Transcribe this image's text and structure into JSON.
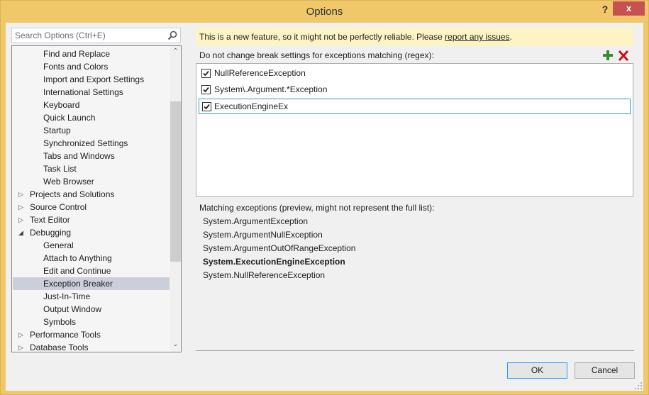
{
  "window": {
    "title": "Options",
    "help_label": "?",
    "close_label": "x",
    "frame_color": "#f0c86a",
    "close_color": "#c75050"
  },
  "search": {
    "placeholder": "Search Options (Ctrl+E)",
    "value": "",
    "icon": "search-icon"
  },
  "tree": {
    "items": [
      {
        "label": "Find and Replace",
        "level": 1,
        "expander": ""
      },
      {
        "label": "Fonts and Colors",
        "level": 1,
        "expander": ""
      },
      {
        "label": "Import and Export Settings",
        "level": 1,
        "expander": ""
      },
      {
        "label": "International Settings",
        "level": 1,
        "expander": ""
      },
      {
        "label": "Keyboard",
        "level": 1,
        "expander": ""
      },
      {
        "label": "Quick Launch",
        "level": 1,
        "expander": ""
      },
      {
        "label": "Startup",
        "level": 1,
        "expander": ""
      },
      {
        "label": "Synchronized Settings",
        "level": 1,
        "expander": ""
      },
      {
        "label": "Tabs and Windows",
        "level": 1,
        "expander": ""
      },
      {
        "label": "Task List",
        "level": 1,
        "expander": ""
      },
      {
        "label": "Web Browser",
        "level": 1,
        "expander": ""
      },
      {
        "label": "Projects and Solutions",
        "level": 0,
        "expander": "collapsed"
      },
      {
        "label": "Source Control",
        "level": 0,
        "expander": "collapsed"
      },
      {
        "label": "Text Editor",
        "level": 0,
        "expander": "collapsed"
      },
      {
        "label": "Debugging",
        "level": 0,
        "expander": "expanded"
      },
      {
        "label": "General",
        "level": 1,
        "expander": ""
      },
      {
        "label": "Attach to Anything",
        "level": 1,
        "expander": ""
      },
      {
        "label": "Edit and Continue",
        "level": 1,
        "expander": ""
      },
      {
        "label": "Exception Breaker",
        "level": 1,
        "expander": "",
        "selected": true
      },
      {
        "label": "Just-In-Time",
        "level": 1,
        "expander": ""
      },
      {
        "label": "Output Window",
        "level": 1,
        "expander": ""
      },
      {
        "label": "Symbols",
        "level": 1,
        "expander": ""
      },
      {
        "label": "Performance Tools",
        "level": 0,
        "expander": "collapsed"
      },
      {
        "label": "Database Tools",
        "level": 0,
        "expander": "collapsed"
      }
    ],
    "selected_label": "Exception Breaker",
    "scroll_position_fraction": 0.19,
    "visible_fraction": 0.55
  },
  "notice": {
    "text": "This is a new feature, so it might not be perfectly reliable. Please ",
    "link_text": "report any issues",
    "suffix": ".",
    "background": "#fcf4c5"
  },
  "regex": {
    "label": "Do not change break settings for exceptions matching (regex):",
    "add_icon": "plus-icon",
    "delete_icon": "delete-x-icon",
    "add_color": "#388a34",
    "delete_color": "#c5141d",
    "rows": [
      {
        "pattern": "NullReferenceException",
        "checked": true,
        "editing": false
      },
      {
        "pattern": "System\\.Argument.*Exception",
        "checked": true,
        "editing": false
      },
      {
        "pattern": "ExecutionEngineEx",
        "checked": true,
        "editing": true
      }
    ]
  },
  "matching": {
    "label": "Matching exceptions (preview, might not represent the full list):",
    "items": [
      {
        "name": "System.ArgumentException",
        "bold": false
      },
      {
        "name": "System.ArgumentNullException",
        "bold": false
      },
      {
        "name": "System.ArgumentOutOfRangeException",
        "bold": false
      },
      {
        "name": "System.ExecutionEngineException",
        "bold": true
      },
      {
        "name": "System.NullReferenceException",
        "bold": false
      }
    ]
  },
  "buttons": {
    "ok": "OK",
    "cancel": "Cancel"
  }
}
